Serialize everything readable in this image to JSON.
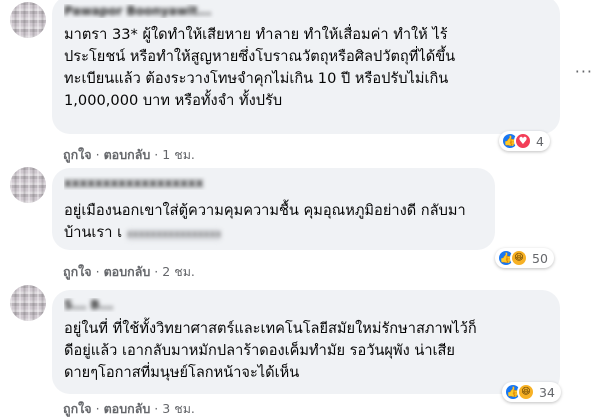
{
  "comments": [
    {
      "author": "Pawapor Boonyawit...",
      "lines": [
        "มาตรา 33* ผู้ใดทำให้เสียหาย ทำลาย ทำให้เสื่อมค่า ทำให้ ไร้",
        "ประโยชน์ หรือทำให้สูญหายซึ่งโบราณวัตถุหรือศิลปวัตถุที่ได้ขึ้น",
        "ทะเบียนแล้ว ต้องระวางโทษจำคุกไม่เกิน 10 ปี หรือปรับไม่เกิน",
        "1,000,000 บาท หรือทั้งจำ ทั้งปรับ"
      ],
      "like_label": "ถูกใจ",
      "reply_label": "ตอบกลับ",
      "time": "1 ชม.",
      "reaction_count": "4",
      "reactions": [
        "like-icon",
        "love-icon"
      ]
    },
    {
      "author": "xxxxxxxxxxxxxxxxxx",
      "lines": [
        "อยู่เมืองนอกเขาใส่ตู้ความคุมความชื้น คุมอุณหภูมิอย่างดี กลับมา",
        "บ้านเรา เ"
      ],
      "redacted_tail": "xxxxxxxxxxxxxxxx",
      "like_label": "ถูกใจ",
      "reply_label": "ตอบกลับ",
      "time": "2 ชม.",
      "reaction_count": "50",
      "reactions": [
        "like-icon",
        "haha-icon"
      ]
    },
    {
      "author": "S... B...",
      "lines": [
        "อยู่ในที่ ที่ใช้ทั้งวิทยาศาสตร์และเทคโนโลยีสมัยใหม่รักษาสภาพไว้ก็",
        "ดีอยู่แล้ว เอากลับมาหมักปลาร้าดองเค็มทำมัย รอวันผุพัง น่าเสีย",
        "ดายๆโอกาสที่มนุษย์โลกหน้าจะได้เห็น"
      ],
      "like_label": "ถูกใจ",
      "reply_label": "ตอบกลับ",
      "time": "3 ชม.",
      "reaction_count": "34",
      "reactions": [
        "like-icon",
        "haha-icon"
      ]
    }
  ],
  "more_label": "···",
  "colors": {
    "bubble": "#f0f2f5",
    "meta_text": "#65676b",
    "like": "#1877f2",
    "love": "#f33e58",
    "haha": "#f7b125"
  }
}
